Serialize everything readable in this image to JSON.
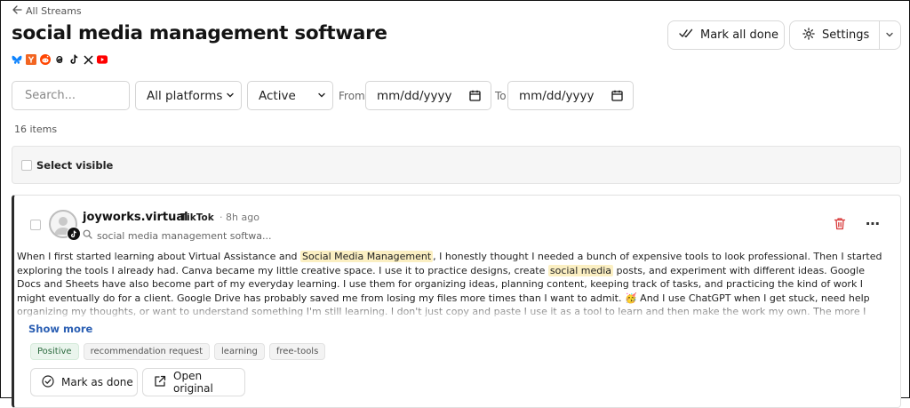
{
  "nav": {
    "back_label": "All Streams"
  },
  "page": {
    "title": "social media management software"
  },
  "platform_icons": [
    "bluesky-icon",
    "ycombinator-icon",
    "reddit-icon",
    "threads-icon",
    "tiktok-icon",
    "x-icon",
    "youtube-icon"
  ],
  "header": {
    "mark_all_label": "Mark all done",
    "settings_label": "Settings"
  },
  "filters": {
    "search_placeholder": "Search...",
    "platform_selected": "All platforms",
    "status_selected": "Active",
    "from_label": "From",
    "from_value": "mm/dd/yyyy",
    "to_label": "To",
    "to_value": "mm/dd/yyyy"
  },
  "summary": {
    "count_text": "16 items",
    "select_visible_label": "Select visible"
  },
  "post": {
    "author": "joyworks.virtual",
    "platform": "TikTok",
    "separator": "·",
    "time_ago": "8h ago",
    "query": "social media management softwa...",
    "body_parts": [
      "When I first started learning about Virtual Assistance and ",
      "Social  Media  Management",
      ", I honestly thought I needed a bunch of expensive tools to look professional. Then I started exploring the tools I already had. Canva became my little creative space. I use it to practice designs, create ",
      "social  media",
      " posts, and experiment with different ideas. Google Docs and Sheets have also become part of my everyday learning. I use them for organizing ideas, planning content, keeping track of tasks, and practicing the kind of work I might eventually do for a client. Google Drive has probably saved me from losing my files more times than I want to admit. 🥳  And I use ChatGPT when I get stuck, need help organizing my thoughts, or want to understand something I'm still learning. I don't just copy and paste I use it as a tool to learn and then make the work my own. The more I learn, the more I"
    ],
    "show_more_label": "Show more",
    "tags": [
      "Positive",
      "recommendation request",
      "learning",
      "free-tools"
    ],
    "mark_done_label": "Mark as done",
    "open_original_label": "Open original"
  },
  "colors": {
    "accent_link": "#2b5fb3",
    "highlight": "#fbefc2",
    "delete_red": "#d83a3a",
    "positive_tag": "#2c6b3f"
  }
}
